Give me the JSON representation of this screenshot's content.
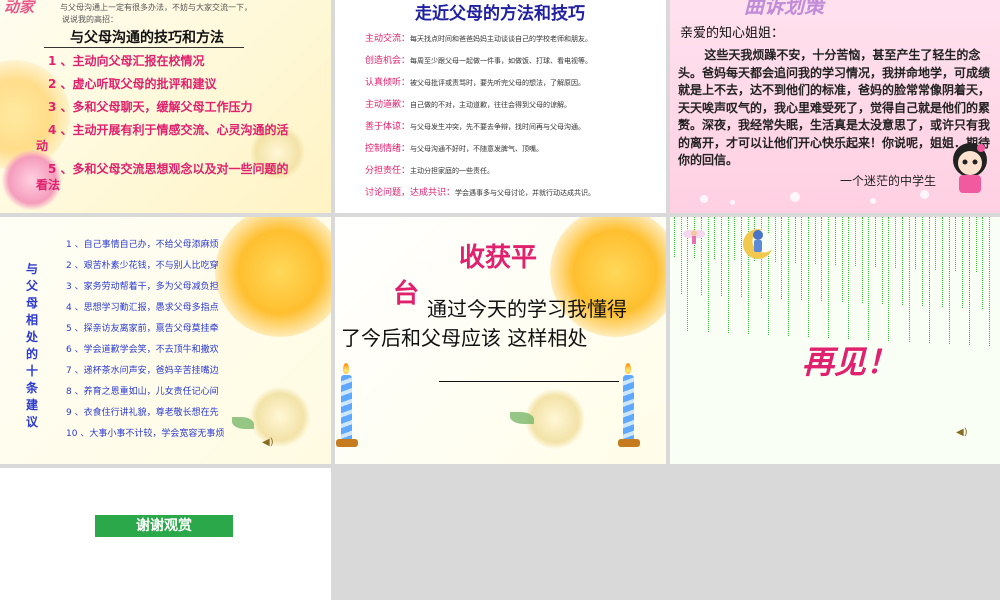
{
  "slide1": {
    "top_title": "动家",
    "sub_line1": "与父母沟通上一定有很多办法，不妨与大家交流一下，",
    "sub_line2": "说说我的高招：",
    "title": "与父母沟通的技巧和方法",
    "items": [
      "1 、主动向父母汇报在校情况",
      "2 、虚心听取父母的批评和建议",
      "3 、多和父母聊天，缓解父母工作压力",
      "4 、主动开展有利于情感交流、心灵沟通的活",
      "动",
      "5 、多和父母交流思想观念以及对一些问题的",
      "看法"
    ]
  },
  "slide2": {
    "title": "走近父母的方法和技巧",
    "rows": [
      {
        "key": "主动交流：",
        "text": "每天找点时间和爸爸妈妈主动谈谈自己的学校老师和朋友。"
      },
      {
        "key": "创造机会：",
        "text": "每周至少跟父母一起做一件事，如做饭、打球、看电视等。"
      },
      {
        "key": "认真倾听：",
        "text": "被父母批评或责骂时，要先听完父母的想法，了解原因。"
      },
      {
        "key": "主动道歉：",
        "text": "自己做的不对，主动道歉，往往会得到父母的谅解。"
      },
      {
        "key": "善于体谅：",
        "text": "与父母发生冲突，先不要去争辩，找时间再与父母沟通。"
      },
      {
        "key": "控制情绪：",
        "text": "与父母沟通不好时，不随意发脾气、顶嘴。"
      },
      {
        "key": "分担责任：",
        "text": "主动分担家庭的一些责任。"
      },
      {
        "key": "讨论问题，达成共识：",
        "text": "学会遇事多与父母讨论，并就行动达成共识。"
      }
    ]
  },
  "slide3": {
    "logo": "曲诉划策",
    "greeting": "亲爱的知心姐姐：",
    "body": "这些天我烦躁不安，十分苦恼，甚至产生了轻生的念头。爸妈每天都会追问我的学习情况，我拼命地学，可成绩就是上不去，达不到他们的标准，爸妈的脸常常像阴着天，天天唉声叹气的，我心里难受死了，觉得自己就是他们的累赘。深夜，我经常失眠，生活真是太没意思了，或许只有我的离开，才可以让他们开心快乐起来！你说呢，姐姐．期待你的回信。",
    "signature": "一个迷茫的中学生"
  },
  "slide4": {
    "vertical_title": [
      "与",
      "父",
      "母",
      "相",
      "处",
      "的",
      "十",
      "条",
      "建",
      "议"
    ],
    "items": [
      "1 、自己事情自己办，不给父母添麻烦",
      "2 、艰苦朴素少花钱，不与别人比吃穿",
      "3 、家务劳动帮着干，多为父母减负担",
      "4 、思想学习勤汇报，愚求父母多指点",
      "5 、探亲访友离家前，禀告父母莫挂牵",
      "6 、学会道歉学会笑，不去顶牛和撒欢",
      "7 、递杯茶水问声安，爸妈辛苦挂嘴边",
      "8 、养育之恩重如山，儿女责任记心间",
      "9 、衣食住行讲礼貌，尊老敬长想在先",
      "10 、大事小事不计较，学会宽容无事烦"
    ]
  },
  "slide5": {
    "title_part1": "收获平",
    "title_part2": "台",
    "body": "通过今天的学习我懂得了今后和父母应该 这样相处"
  },
  "slide6": {
    "farewell": "再见！"
  },
  "slide7": {
    "thanks": "谢谢观赏"
  },
  "colors": {
    "accent_pink": "#e0216e",
    "accent_blue": "#2a3ad0",
    "green_button": "#2aa84a"
  }
}
